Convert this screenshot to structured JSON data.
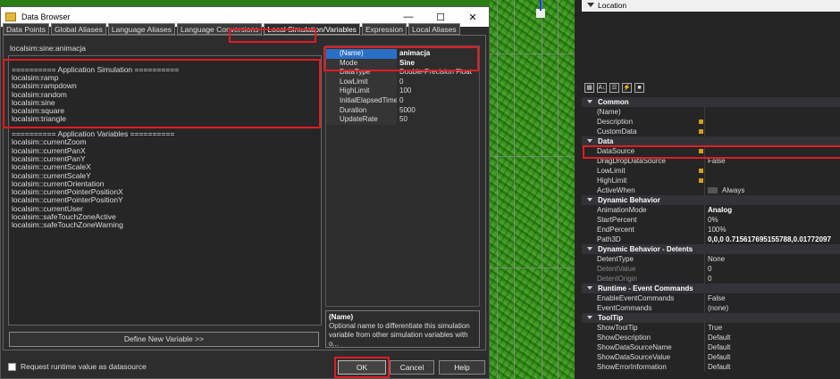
{
  "window": {
    "title": "Data Browser",
    "minimize": "—",
    "maximize": "☐",
    "close": "✕"
  },
  "tabs": [
    {
      "label": "Data Points"
    },
    {
      "label": "Global Aliases"
    },
    {
      "label": "Language Aliases"
    },
    {
      "label": "Language Conversions"
    },
    {
      "label": "Local Simulation/Variables"
    },
    {
      "label": "Expression"
    },
    {
      "label": "Local Aliases"
    }
  ],
  "path_value": "localsim:sine:animacja",
  "list": [
    "========== Application Simulation ==========",
    "localsim:ramp",
    "localsim:rampdown",
    "localsim:random",
    "localsim:sine",
    "localsim:square",
    "localsim:triangle",
    "",
    "========== Application Variables ==========",
    "localsim::currentZoom",
    "localsim::currentPanX",
    "localsim::currentPanY",
    "localsim::currentScaleX",
    "localsim::currentScaleY",
    "localsim::currentOrientation",
    "localsim::currentPointerPositionX",
    "localsim::currentPointerPositionY",
    "localsim::currentUser",
    "localsim::safeTouchZoneActive",
    "localsim::safeTouchZoneWarning"
  ],
  "define_button": "Define New Variable >>",
  "runtime_checkbox_label": "Request runtime value as datasource",
  "buttons": {
    "ok": "OK",
    "cancel": "Cancel",
    "help": "Help"
  },
  "properties": [
    {
      "name": "(Name)",
      "value": "animacja"
    },
    {
      "name": "Mode",
      "value": "Sine"
    },
    {
      "name": "DataType",
      "value": "Double-Precision Float"
    },
    {
      "name": "LowLimit",
      "value": "0"
    },
    {
      "name": "HighLimit",
      "value": "100"
    },
    {
      "name": "InitialElapsedTime",
      "value": "0"
    },
    {
      "name": "Duration",
      "value": "5000"
    },
    {
      "name": "UpdateRate",
      "value": "50"
    }
  ],
  "description": {
    "title": "(Name)",
    "text": "Optional name to differentiate this simulation variable from other simulation variables with o..."
  },
  "right_panel": {
    "top_label": "Location",
    "toolbar_icons": [
      "categorized-icon",
      "alphabetical-icon",
      "properties-icon",
      "events-icon",
      "property-pages-icon"
    ],
    "rows": [
      {
        "type": "cat",
        "label": "Common"
      },
      {
        "type": "row",
        "name": "(Name)",
        "value": ""
      },
      {
        "type": "row",
        "name": "Description",
        "value": "",
        "pin": true
      },
      {
        "type": "row",
        "name": "CustomData",
        "value": "",
        "pin": true
      },
      {
        "type": "cat",
        "label": "Data"
      },
      {
        "type": "row",
        "name": "DataSource",
        "value": "",
        "pin": true
      },
      {
        "type": "row",
        "name": "DragDropDataSource",
        "value": "False"
      },
      {
        "type": "row",
        "name": "LowLimit",
        "value": "",
        "pin": true
      },
      {
        "type": "row",
        "name": "HighLimit",
        "value": "",
        "pin": true
      },
      {
        "type": "row",
        "name": "ActiveWhen",
        "value": "Always",
        "check": true
      },
      {
        "type": "cat",
        "label": "Dynamic Behavior"
      },
      {
        "type": "row",
        "name": "AnimationMode",
        "value": "Analog",
        "bold": true
      },
      {
        "type": "row",
        "name": "StartPercent",
        "value": "0%"
      },
      {
        "type": "row",
        "name": "EndPercent",
        "value": "100%"
      },
      {
        "type": "row",
        "name": "Path3D",
        "value": "0,0,0 0.715617695155788,0.01772097",
        "bold": true
      },
      {
        "type": "cat",
        "label": "Dynamic Behavior - Detents"
      },
      {
        "type": "row",
        "name": "DetentType",
        "value": "None"
      },
      {
        "type": "row",
        "name": "DetentValue",
        "value": "0",
        "dim": true
      },
      {
        "type": "row",
        "name": "DetentOrigin",
        "value": "0",
        "dim": true
      },
      {
        "type": "cat",
        "label": "Runtime - Event Commands"
      },
      {
        "type": "row",
        "name": "EnableEventCommands",
        "value": "False"
      },
      {
        "type": "row",
        "name": "EventCommands",
        "value": "(none)"
      },
      {
        "type": "cat",
        "label": "ToolTip"
      },
      {
        "type": "row",
        "name": "ShowToolTip",
        "value": "True"
      },
      {
        "type": "row",
        "name": "ShowDescription",
        "value": "Default"
      },
      {
        "type": "row",
        "name": "ShowDataSourceName",
        "value": "Default"
      },
      {
        "type": "row",
        "name": "ShowDataSourceValue",
        "value": "Default"
      },
      {
        "type": "row",
        "name": "ShowErrorInformation",
        "value": "Default"
      }
    ]
  }
}
